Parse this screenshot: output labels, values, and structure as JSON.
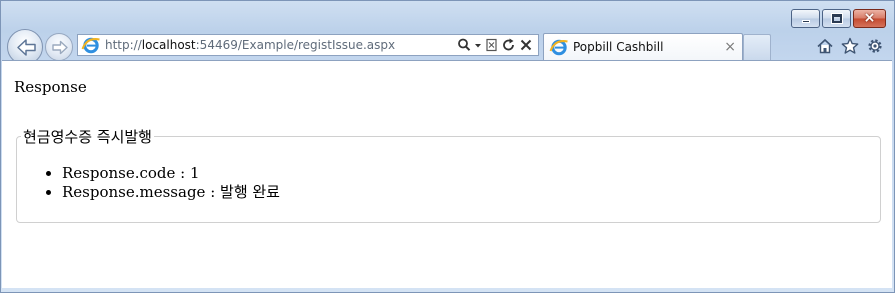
{
  "browser": {
    "url_prefix": "http://",
    "url_host": "localhost",
    "url_rest": ":54469/Example/registIssue.aspx",
    "tab_title": "Popbill Cashbill",
    "tab_close": "×",
    "caption_close": "×"
  },
  "page": {
    "heading": "Response",
    "fieldset_legend": "현금영수증 즉시발행",
    "results": [
      {
        "label": "Response.code : ",
        "value": "1"
      },
      {
        "label": "Response.message : ",
        "value": "발행 완료"
      }
    ]
  },
  "colors": {
    "frame": "#bcd1ea",
    "close_button": "#c44a30",
    "fieldset_border": "#d0d0d0"
  },
  "icons": [
    "back-arrow-icon",
    "forward-arrow-icon",
    "ie-logo-icon",
    "search-icon",
    "dropdown-arrow-icon",
    "compatibility-view-icon",
    "refresh-icon",
    "stop-icon",
    "home-icon",
    "favorites-star-icon",
    "gear-icon"
  ]
}
